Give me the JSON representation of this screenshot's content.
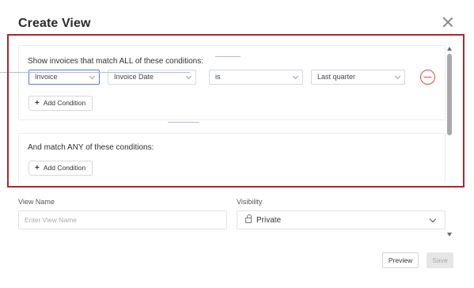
{
  "modal": {
    "title": "Create View",
    "close_icon": "close-icon"
  },
  "all_conditions": {
    "heading": "Show invoices that match ALL of these conditions:",
    "row": {
      "object": "Invoice",
      "field": "Invoice Date",
      "operator": "is",
      "value": "Last quarter"
    },
    "add_label": "Add Condition"
  },
  "any_conditions": {
    "heading": "And match ANY of these conditions:",
    "add_label": "Add Condition"
  },
  "view_name": {
    "label": "View Name",
    "placeholder": "Enter View Name",
    "value": ""
  },
  "visibility": {
    "label": "Visibility",
    "selected": "Private",
    "icon": "lock-icon"
  },
  "footer": {
    "preview_label": "Preview",
    "save_label": "Save"
  },
  "colors": {
    "highlight_border": "#a8282b",
    "remove_accent": "#d64a4a",
    "focus_border": "#4a7fd6"
  }
}
